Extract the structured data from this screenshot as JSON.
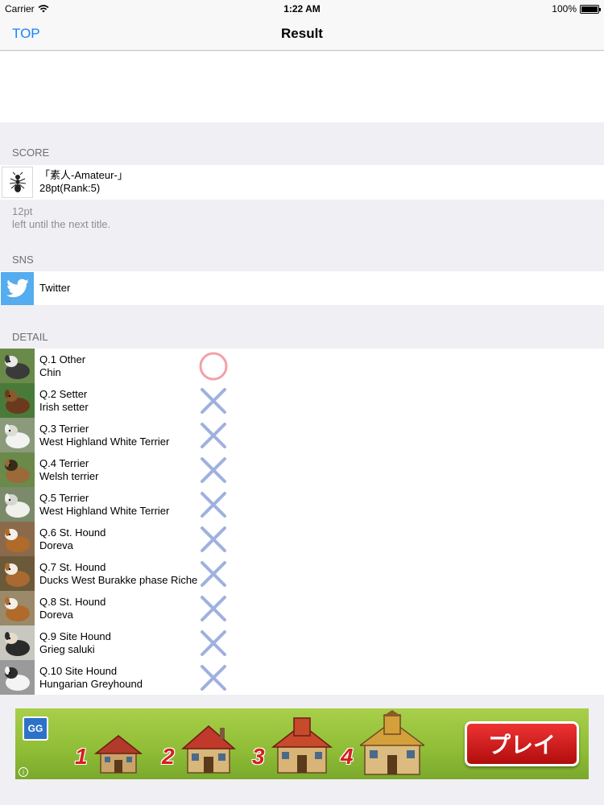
{
  "status_bar": {
    "carrier": "Carrier",
    "time": "1:22 AM",
    "battery": "100%",
    "battery_level": 1.0
  },
  "nav": {
    "back_label": "TOP",
    "title": "Result"
  },
  "score_section": {
    "header": "SCORE",
    "icon": "ant-icon",
    "title_line": "「素人-Amateur-」",
    "points_line": "28pt(Rank:5)",
    "note_points": "12pt",
    "note_text": "left until the next title."
  },
  "sns_section": {
    "header": "SNS",
    "icon": "twitter-bird-icon",
    "twitter_label": "Twitter"
  },
  "detail_section": {
    "header": "DETAIL",
    "items": [
      {
        "question": "Q.1 Other",
        "answer": "Chin",
        "correct": true
      },
      {
        "question": "Q.2 Setter",
        "answer": "Irish setter",
        "correct": false
      },
      {
        "question": "Q.3 Terrier",
        "answer": "West Highland White Terrier",
        "correct": false
      },
      {
        "question": "Q.4 Terrier",
        "answer": "Welsh terrier",
        "correct": false
      },
      {
        "question": "Q.5 Terrier",
        "answer": "West Highland White Terrier",
        "correct": false
      },
      {
        "question": "Q.6 St. Hound",
        "answer": "Doreva",
        "correct": false
      },
      {
        "question": "Q.7 St. Hound",
        "answer": "Ducks West Burakke phase Riche",
        "correct": false
      },
      {
        "question": "Q.8 St. Hound",
        "answer": "Doreva",
        "correct": false
      },
      {
        "question": "Q.9 Site Hound",
        "answer": "Grieg saluki",
        "correct": false
      },
      {
        "question": "Q.10 Site Hound",
        "answer": "Hungarian Greyhound",
        "correct": false
      }
    ]
  },
  "colors": {
    "accent": "#1a82fb",
    "twitter": "#55acee",
    "correct_circle": "#f2a0a8",
    "wrong_cross": "#9fb1de"
  },
  "ad": {
    "logo_text": "GG",
    "numbers": [
      "1",
      "2",
      "3",
      "4"
    ],
    "play_label": "プレイ",
    "info_icon": "i"
  }
}
